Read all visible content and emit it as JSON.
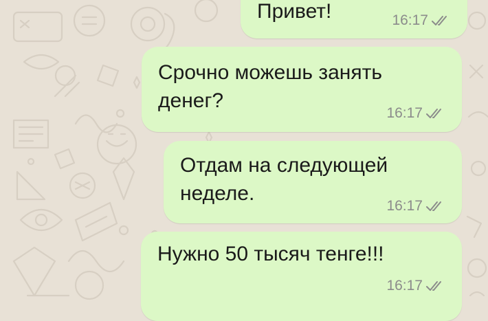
{
  "chat": {
    "messages": [
      {
        "lines": [
          "Привет!"
        ],
        "time": "16:17",
        "status": "read"
      },
      {
        "lines": [
          "Срочно можешь занять",
          "денег?"
        ],
        "time": "16:17",
        "status": "read"
      },
      {
        "lines": [
          "Отдам на следующей",
          "неделе."
        ],
        "time": "16:17",
        "status": "read"
      },
      {
        "lines": [
          "Нужно 50 тысяч тенге!!!"
        ],
        "time": "16:17",
        "status": "read"
      }
    ]
  },
  "colors": {
    "outgoing_bubble": "#dcf8c6",
    "wallpaper": "#e8e1d6",
    "doodle": "#d7cfc3",
    "meta_text": "#8b8b8b"
  },
  "icons": {
    "status": "double-check-icon",
    "wallpaper": "doodle-pattern"
  }
}
